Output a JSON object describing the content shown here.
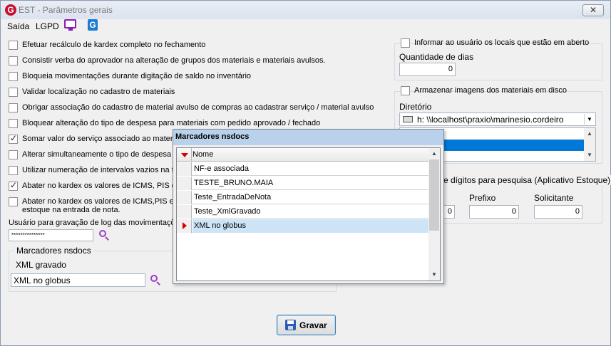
{
  "window": {
    "title": "EST - Parâmetros gerais",
    "close_glyph": "✕"
  },
  "menu": {
    "items": [
      "Saída",
      "LGPD"
    ],
    "icons": [
      "monitor-icon",
      "g-app-icon"
    ]
  },
  "left_checks": [
    {
      "label": "Efetuar recálculo de kardex completo no fechamento",
      "checked": false
    },
    {
      "label": "Consistir verba do aprovador na alteração de grupos dos materiais e materiais avulsos.",
      "checked": false
    },
    {
      "label": "Bloqueia movimentações durante digitação de saldo no inventário",
      "checked": false
    },
    {
      "label": "Validar localização no cadastro de materiais",
      "checked": false
    },
    {
      "label": "Obrigar associação do cadastro de material avulso de compras ao cadastrar serviço / material avulso",
      "checked": false
    },
    {
      "label": "Bloquear alteração do tipo de despesa para materiais com pedido aprovado / fechado",
      "checked": false
    },
    {
      "label": "Somar valor do serviço associado ao materia",
      "checked": true
    },
    {
      "label": "Alterar simultaneamente o tipo de despesa d",
      "checked": false
    },
    {
      "label": "Utilizar numeração de intervalos vazios na tr",
      "checked": false
    },
    {
      "label": "Abater no kardex os valores de ICMS, PIS e",
      "checked": true
    },
    {
      "label": "Abater no kardex os valores de ICMS,PIS e",
      "label2": "estoque na entrada de nota.",
      "checked": false
    }
  ],
  "log_user": {
    "label": "Usuário para gravação de log das movimentaçõ",
    "value": "***************"
  },
  "marcadores_group": {
    "legend": "Marcadores nsdocs",
    "sublabel": "XML gravado",
    "value": "XML no globus"
  },
  "right_panel": {
    "informar": {
      "label": "Informar ao usuário os locais que estão em aberto",
      "qty_label": "Quantidade de dias",
      "qty_value": "0"
    },
    "armazenar": {
      "label": "Armazenar imagens dos materiais em disco",
      "dir_label": "Diretório",
      "dir_value": "h: \\\\localhost\\praxio\\marinesio.cordeiro"
    },
    "digitos": {
      "legend": "e dígitos para pesquisa (Aplicativo Estoque)",
      "fields": [
        {
          "label": "",
          "value": "0"
        },
        {
          "label": "Prefixo",
          "value": "0"
        },
        {
          "label": "Solicitante",
          "value": "0"
        }
      ]
    }
  },
  "popup": {
    "title": "Marcadores nsdocs",
    "column": "Nome",
    "rows": [
      "NF-e associada",
      "TESTE_BRUNO.MAIA",
      "Teste_EntradaDeNota",
      "Teste_XmlGravado",
      "XML no globus"
    ],
    "selected_index": 4
  },
  "save_button": {
    "label": "Gravar"
  },
  "colors": {
    "accent": "#0078d7",
    "popup_title": "#b9d1ea",
    "search_icon": "#9b3fc7",
    "indicator": "#d80000"
  }
}
